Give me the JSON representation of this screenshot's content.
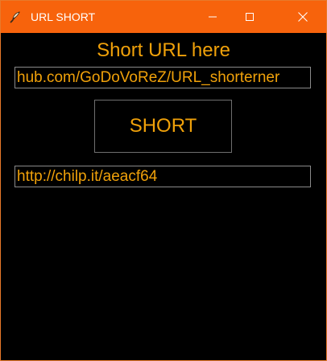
{
  "window": {
    "title": "URL SHORT",
    "icons": {
      "app": "feather-quill-icon",
      "minimize": "minimize-icon",
      "maximize": "maximize-icon",
      "close": "close-icon"
    },
    "colors": {
      "titlebar": "#f7630c",
      "background": "#000000",
      "accent_text": "#f0a10a",
      "field_border": "#8a8a8a"
    }
  },
  "main": {
    "heading": "Short URL here",
    "url_input_value": "hub.com/GoDoVoReZ/URL_shorterner",
    "short_button_label": "SHORT",
    "result_value": "http://chilp.it/aeacf64"
  }
}
